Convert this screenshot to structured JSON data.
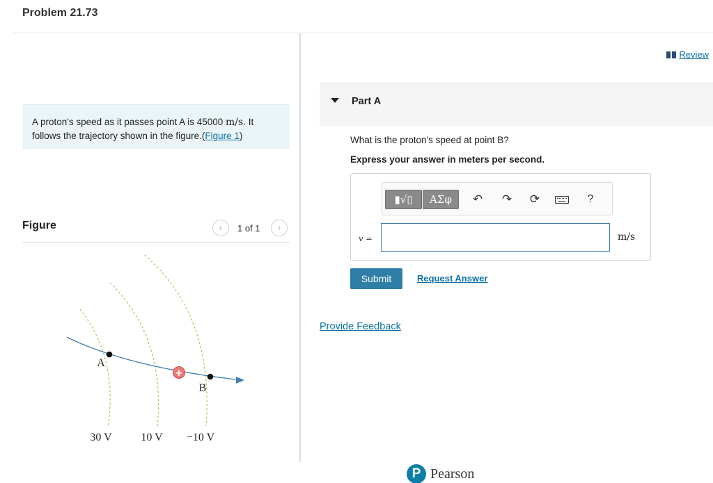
{
  "problem": {
    "title": "Problem 21.73"
  },
  "statement": {
    "text_before": "A proton's speed as it passes point A is 45000",
    "unit": "m/s",
    "text_after": ". It follows the trajectory shown in the figure.",
    "figure_link_open": "(",
    "figure_link": "Figure 1",
    "figure_link_close": ")"
  },
  "figure": {
    "title": "Figure",
    "pager": "1 of 1",
    "prev_icon": "chevron-left-icon",
    "next_icon": "chevron-right-icon",
    "point_a": "A",
    "point_b": "B",
    "equipotentials": [
      "30 V",
      "10 V",
      "−10 V"
    ],
    "proton_symbol": "+"
  },
  "review": {
    "label": "Review",
    "icon": "book-icon"
  },
  "part": {
    "label": "Part A",
    "question": "What is the proton's speed at point B?",
    "instruction": "Express your answer in meters per second."
  },
  "toolbar": {
    "templates_label": "▮√▯",
    "greek_label": "ΑΣφ",
    "undo_icon": "undo-icon",
    "redo_icon": "redo-icon",
    "reset_icon": "reset-icon",
    "keyboard_icon": "keyboard-icon",
    "help_label": "?"
  },
  "answer": {
    "variable": "v =",
    "value": "",
    "unit": "m/s"
  },
  "actions": {
    "submit": "Submit",
    "request_answer": "Request Answer"
  },
  "feedback": {
    "label": "Provide Feedback"
  },
  "footer": {
    "brand": "Pearson",
    "logo_letter": "P"
  },
  "colors": {
    "link": "#0b6fa4",
    "submit_bg": "#2e7ea8",
    "statement_bg": "#ebf5f7",
    "proton": "#e87a7a",
    "trajectory": "#3b7fb8",
    "equipotential": "#9bc95a"
  }
}
